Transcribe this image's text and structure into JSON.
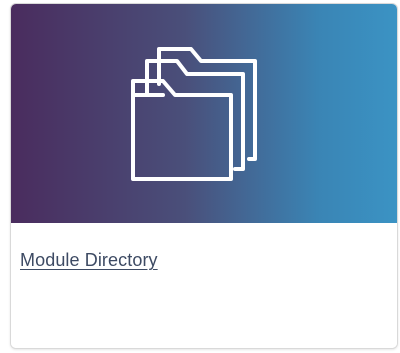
{
  "card": {
    "title": "Module Directory",
    "icon": "folders-icon"
  },
  "colors": {
    "gradient_start": "#4a2c5e",
    "gradient_end": "#3b93c4",
    "link": "#3d4a63"
  }
}
